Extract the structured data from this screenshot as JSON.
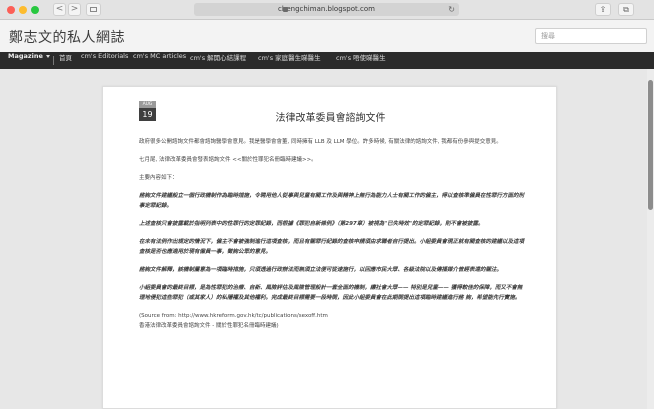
{
  "browser": {
    "url": "chengchiman.blogspot.com",
    "back_glyph": "<",
    "forward_glyph": ">",
    "reload_glyph": "↻",
    "share_glyph": "⇪",
    "tabs_glyph": "⧉"
  },
  "blog": {
    "title": "鄭志文的私人網誌",
    "search_placeholder": "搜尋"
  },
  "nav": {
    "magazine": "Magazine",
    "items": [
      "首頁",
      "cm's Editorials",
      "cm's MC articles",
      "cm's 解開心結課程",
      "cm's 家庭醫生睇醫生",
      "cm's 唔使睇醫生"
    ]
  },
  "post": {
    "month": "AUG",
    "day": "19",
    "title": "法律改革委員會諮詢文件",
    "p1": "政府很多公開諮詢文件都會諮詢醫學會意見。我是醫學會會董, 同時擁有 LLB 及 LLM 學位。許多時候, 有關法律的諮詢文件, 我都有份參與提交意見。",
    "p2": "七月尾, 法律改革委員會發表諮詢文件 <<關於性罪犯名冊臨時建議>>。",
    "p3": "主要內容如下：",
    "p4": "諮詢文件建議設立一個行政機制作為臨時措施，令聘用他人從事與兒童有關工作及與精神上無行為能力人士有關工作的僱主，得以查核準僱員在性罪行方面的刑事定罪紀錄。",
    "p5": "上述查核只會披露載於指明列表中的性罪行的定罪紀錄，而根據《罪犯自新條例》（第297章）被視為\"已失時效\"的定罪紀錄，則不會被披露。",
    "p6": "在未有法例作出規定的情況下，僱主不會被強制進行這項查核，而且有關罪行紀錄的查核申請須由求職者自行提出。小組委員會現正就有關查核的建議以及這項查核是否也應適用於現有僱員一事，徵詢公眾的意見。",
    "p7": "諮詢文件解釋，該機制屬意為一項臨時措施，只須透過行政辦法而無須立法便可從速施行，以回應市民大眾、各級法院以及傳播媒介曾經表達的關注。",
    "p8": "小組委員會的最終目標，是為性罪犯的治療、自新、風險評估及風險管理設計一套全面的機制，讓社會大眾—— 特別是兒童—— 獲得較佳的保障，而又不會無理地侵犯這些罪犯（或其家人）的私隱權及其他權利。完成最終目標需要一段時間，因此小組委員會在此期間提出這項臨時建議進行諮 詢，希望能先行實施。",
    "source_line": "(Source from: http://www.hkreform.gov.hk/tc/publications/sexoff.htm",
    "source_title": "香港法律改革委員會諮詢文件 - 關於性罪犯名冊臨時建議)"
  }
}
